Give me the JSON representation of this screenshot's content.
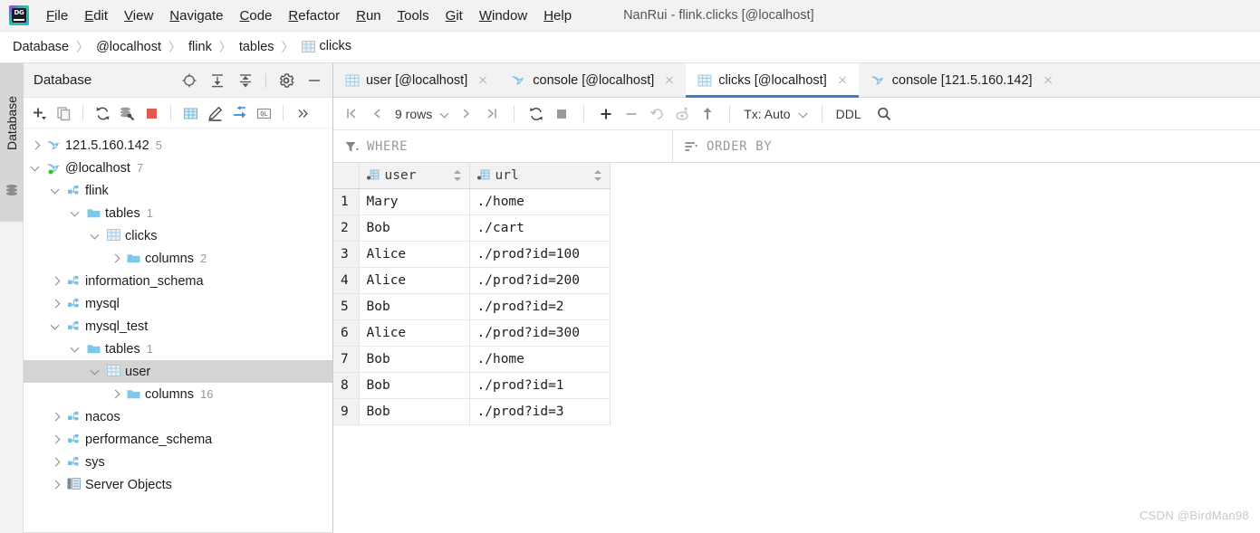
{
  "window": {
    "title": "NanRui - flink.clicks [@localhost]",
    "app_icon": "datagrip-logo-icon"
  },
  "menubar": {
    "items": [
      {
        "label": "File",
        "mnemonic": "F"
      },
      {
        "label": "Edit",
        "mnemonic": "E"
      },
      {
        "label": "View",
        "mnemonic": "V"
      },
      {
        "label": "Navigate",
        "mnemonic": "N"
      },
      {
        "label": "Code",
        "mnemonic": "C"
      },
      {
        "label": "Refactor",
        "mnemonic": "R"
      },
      {
        "label": "Run",
        "mnemonic": "R"
      },
      {
        "label": "Tools",
        "mnemonic": "T"
      },
      {
        "label": "Git",
        "mnemonic": "G"
      },
      {
        "label": "Window",
        "mnemonic": "W"
      },
      {
        "label": "Help",
        "mnemonic": "H"
      }
    ]
  },
  "breadcrumb": {
    "separator": "〉",
    "items": [
      {
        "label": "Database",
        "icon": null
      },
      {
        "label": "@localhost",
        "icon": null
      },
      {
        "label": "flink",
        "icon": null
      },
      {
        "label": "tables",
        "icon": null
      },
      {
        "label": "clicks",
        "icon": "table-icon"
      }
    ]
  },
  "tool_strip": {
    "label": "Database",
    "icon": "database-stack-icon"
  },
  "database_panel": {
    "title": "Database",
    "header_icons": [
      {
        "name": "locate-icon"
      },
      {
        "name": "expand-all-icon"
      },
      {
        "name": "collapse-all-icon"
      },
      {
        "name": "settings-gear-icon"
      },
      {
        "name": "hide-minimize-icon"
      }
    ],
    "toolbar_icons": [
      {
        "name": "add-new-icon"
      },
      {
        "name": "duplicate-icon"
      },
      {
        "name": "refresh-icon"
      },
      {
        "name": "database-tools-icon"
      },
      {
        "name": "stop-icon"
      },
      {
        "name": "table-editor-icon"
      },
      {
        "name": "modify-pencil-icon"
      },
      {
        "name": "jump-to-editor-icon"
      },
      {
        "name": "query-ql-icon"
      },
      {
        "name": "more-chevrons-icon"
      }
    ],
    "tree": [
      {
        "label": "121.5.160.142",
        "count": "5",
        "indent": 0,
        "state": "collapsed",
        "icon": "dolphin-icon",
        "selected": false
      },
      {
        "label": "@localhost",
        "count": "7",
        "indent": 0,
        "state": "expanded",
        "icon": "dolphin-live-icon",
        "selected": false
      },
      {
        "label": "flink",
        "count": "",
        "indent": 1,
        "state": "expanded",
        "icon": "schema-icon",
        "selected": false
      },
      {
        "label": "tables",
        "count": "1",
        "indent": 2,
        "state": "expanded",
        "icon": "folder-icon",
        "selected": false
      },
      {
        "label": "clicks",
        "count": "",
        "indent": 3,
        "state": "expanded",
        "icon": "table-icon",
        "selected": false
      },
      {
        "label": "columns",
        "count": "2",
        "indent": 4,
        "state": "collapsed",
        "icon": "folder-icon",
        "selected": false
      },
      {
        "label": "information_schema",
        "count": "",
        "indent": 1,
        "state": "collapsed",
        "icon": "schema-icon",
        "selected": false
      },
      {
        "label": "mysql",
        "count": "",
        "indent": 1,
        "state": "collapsed",
        "icon": "schema-icon",
        "selected": false
      },
      {
        "label": "mysql_test",
        "count": "",
        "indent": 1,
        "state": "expanded",
        "icon": "schema-icon",
        "selected": false
      },
      {
        "label": "tables",
        "count": "1",
        "indent": 2,
        "state": "expanded",
        "icon": "folder-icon",
        "selected": false
      },
      {
        "label": "user",
        "count": "",
        "indent": 3,
        "state": "expanded",
        "icon": "table-icon",
        "selected": true
      },
      {
        "label": "columns",
        "count": "16",
        "indent": 4,
        "state": "collapsed",
        "icon": "folder-icon",
        "selected": false
      },
      {
        "label": "nacos",
        "count": "",
        "indent": 1,
        "state": "collapsed",
        "icon": "schema-icon",
        "selected": false
      },
      {
        "label": "performance_schema",
        "count": "",
        "indent": 1,
        "state": "collapsed",
        "icon": "schema-icon",
        "selected": false
      },
      {
        "label": "sys",
        "count": "",
        "indent": 1,
        "state": "collapsed",
        "icon": "schema-icon",
        "selected": false
      },
      {
        "label": "Server Objects",
        "count": "",
        "indent": 1,
        "state": "collapsed",
        "icon": "server-objects-icon",
        "selected": false
      }
    ]
  },
  "editor_tabs": [
    {
      "label": "user [@localhost]",
      "icon": "table-icon",
      "active": false,
      "closable": true
    },
    {
      "label": "console [@localhost]",
      "icon": "console-icon",
      "active": false,
      "closable": true
    },
    {
      "label": "clicks [@localhost]",
      "icon": "table-icon",
      "active": true,
      "closable": true
    },
    {
      "label": "console [121.5.160.142]",
      "icon": "console-icon",
      "active": false,
      "closable": true
    }
  ],
  "grid_toolbar": {
    "first_page_icon": "first-page-icon",
    "prev_page_icon": "prev-page-icon",
    "rows_label": "9 rows",
    "rows_dropdown_icon": "chevron-down-icon",
    "next_page_icon": "next-page-icon",
    "last_page_icon": "last-page-icon",
    "reload_icon": "reload-icon",
    "cancel_icon": "stop-icon",
    "add_row_icon": "plus-icon",
    "delete_row_icon": "minus-icon",
    "revert_icon": "revert-icon",
    "rollback_icon": "rollback-icon",
    "submit_icon": "submit-arrow-up-icon",
    "tx_label": "Tx: Auto",
    "tx_dropdown_icon": "chevron-down-icon",
    "ddl_label": "DDL",
    "search_icon": "search-icon"
  },
  "filter_bar": {
    "where": {
      "icon": "filter-funnel-icon",
      "placeholder": "WHERE",
      "value": ""
    },
    "order_by": {
      "icon": "sort-lines-icon",
      "placeholder": "ORDER BY",
      "value": ""
    }
  },
  "data_grid": {
    "columns": [
      {
        "name": "user",
        "icon": "text-column-icon",
        "sortable": true
      },
      {
        "name": "url",
        "icon": "text-column-icon",
        "sortable": true
      }
    ],
    "rows": [
      {
        "n": "1",
        "user": "Mary",
        "url": "./home"
      },
      {
        "n": "2",
        "user": "Bob",
        "url": "./cart"
      },
      {
        "n": "3",
        "user": "Alice",
        "url": "./prod?id=100"
      },
      {
        "n": "4",
        "user": "Alice",
        "url": "./prod?id=200"
      },
      {
        "n": "5",
        "user": "Bob",
        "url": "./prod?id=2"
      },
      {
        "n": "6",
        "user": "Alice",
        "url": "./prod?id=300"
      },
      {
        "n": "7",
        "user": "Bob",
        "url": "./home"
      },
      {
        "n": "8",
        "user": "Bob",
        "url": "./prod?id=1"
      },
      {
        "n": "9",
        "user": "Bob",
        "url": "./prod?id=3"
      }
    ]
  },
  "watermark": "CSDN @BirdMan98",
  "colors": {
    "accent_blue": "#3d7dca",
    "selection_gray": "#d4d4d4",
    "panel_gray": "#f2f2f2",
    "icon_blue": "#6fc2e8",
    "stop_red": "#e05a52",
    "muted_text": "#9a9a9a"
  }
}
